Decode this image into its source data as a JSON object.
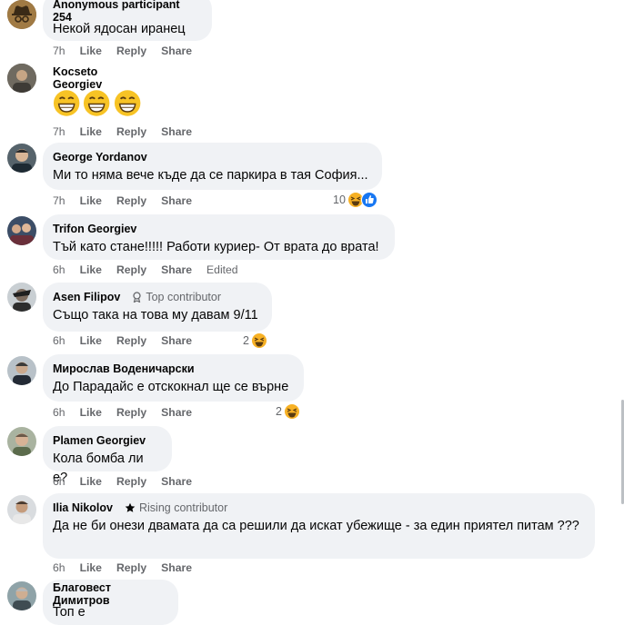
{
  "comments": [
    {
      "author": "Anonymous participant 254",
      "badge": "",
      "text": "Некой ядосан иранец",
      "time": "7h",
      "like": "Like",
      "reply": "Reply",
      "share": "Share",
      "edited": "",
      "reactions": ""
    },
    {
      "author": "Kocseto Georgiev",
      "badge": "",
      "text": "😁😁😁",
      "time": "7h",
      "like": "Like",
      "reply": "Reply",
      "share": "Share",
      "edited": "",
      "reactions": ""
    },
    {
      "author": "George Yordanov",
      "badge": "",
      "text": "Ми то няма вече къде да се паркира в тая София...",
      "time": "7h",
      "like": "Like",
      "reply": "Reply",
      "share": "Share",
      "edited": "",
      "reactions": "10"
    },
    {
      "author": "Trifon Georgiev",
      "badge": "",
      "text": "Тъй като стане!!!!! Работи куриер- От врата до врата!",
      "time": "6h",
      "like": "Like",
      "reply": "Reply",
      "share": "Share",
      "edited": "Edited",
      "reactions": ""
    },
    {
      "author": "Asen Filipov",
      "badge": "Top contributor",
      "text": "Също така на това му давам 9/11",
      "time": "6h",
      "like": "Like",
      "reply": "Reply",
      "share": "Share",
      "edited": "",
      "reactions": "2"
    },
    {
      "author": "Мирослав Воденичарски",
      "badge": "",
      "text": "До Парадайс е отскокнал ще се върне",
      "time": "6h",
      "like": "Like",
      "reply": "Reply",
      "share": "Share",
      "edited": "",
      "reactions": "2"
    },
    {
      "author": "Plamen Georgiev",
      "badge": "",
      "text": "Кола бомба ли е?",
      "time": "6h",
      "like": "Like",
      "reply": "Reply",
      "share": "Share",
      "edited": "",
      "reactions": ""
    },
    {
      "author": "Ilia Nikolov",
      "badge": "Rising contributor",
      "text": "Да не би онези двамата да са решили да искат убежище - за един приятел питам ???",
      "time": "6h",
      "like": "Like",
      "reply": "Reply",
      "share": "Share",
      "edited": "",
      "reactions": ""
    },
    {
      "author": "Благовест Димитров",
      "badge": "",
      "text": "Топ е",
      "time": "",
      "like": "",
      "reply": "",
      "share": "",
      "edited": "",
      "reactions": ""
    }
  ],
  "colors": {
    "bubble": "#f0f2f5",
    "meta": "#65676b",
    "haha": "#f7b125",
    "like_blue": "#1877f2"
  }
}
